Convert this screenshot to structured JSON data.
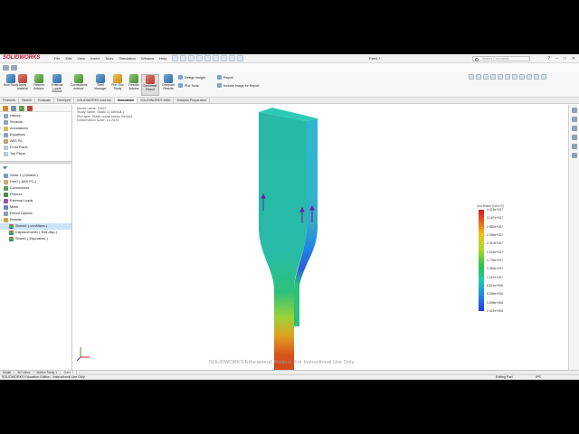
{
  "app": {
    "logo": "SOLIDWORKS",
    "document_title": "Part1 *",
    "menu": [
      "File",
      "Edit",
      "View",
      "Insert",
      "Tools",
      "Simulation",
      "Window",
      "Help"
    ],
    "search_placeholder": "Search Commands",
    "window_controls": [
      "?",
      "–",
      "□",
      "✕"
    ]
  },
  "command_manager": {
    "buttons": [
      {
        "label": "New Study",
        "icon": "new-study-icon"
      },
      {
        "label": "Apply Material",
        "icon": "apply-material-icon"
      },
      {
        "label": "Fixtures Advisor",
        "icon": "fixtures-icon"
      },
      {
        "label": "External Loads Advisor",
        "icon": "loads-icon"
      },
      {
        "label": "Connections Advisor",
        "icon": "connections-icon"
      },
      {
        "label": "Shell Manager",
        "icon": "shell-icon"
      },
      {
        "label": "Run This Study",
        "icon": "run-icon"
      },
      {
        "label": "Results Advisor",
        "icon": "results-icon"
      },
      {
        "label": "Deformed Result",
        "icon": "deformed-icon"
      },
      {
        "label": "Compare Results",
        "icon": "compare-icon"
      }
    ],
    "small_buttons": [
      "Design Insight",
      "Plot Tools",
      "Report",
      "Include Image for Report"
    ]
  },
  "tabs": [
    "Features",
    "Sketch",
    "Evaluate",
    "DimXpert",
    "SOLIDWORKS Add-Ins",
    "Simulation",
    "SOLIDWORKS MBD",
    "Analysis Preparation"
  ],
  "active_tab": "Simulation",
  "feature_tree": [
    {
      "label": "History",
      "icon": "history-icon",
      "expand": "›"
    },
    {
      "label": "Sensors",
      "icon": "sensor-icon",
      "expand": ""
    },
    {
      "label": "Annotations",
      "icon": "annotation-icon",
      "expand": "›"
    },
    {
      "label": "Equations",
      "icon": "equation-icon",
      "expand": "›"
    },
    {
      "label": "ABS PC",
      "icon": "material-icon",
      "expand": ""
    },
    {
      "label": "Front Plane",
      "icon": "plane-icon",
      "expand": ""
    },
    {
      "label": "Top Plane",
      "icon": "plane-icon",
      "expand": ""
    }
  ],
  "study_tree": [
    {
      "label": "Static 1 (-Default-)",
      "icon": "study-icon",
      "expand": "",
      "selected": false
    },
    {
      "label": "Part1 (-ABS PC-)",
      "icon": "part-icon",
      "expand": "›",
      "selected": false
    },
    {
      "label": "Connections",
      "icon": "connections-icon",
      "expand": "",
      "selected": false
    },
    {
      "label": "Fixtures",
      "icon": "fixture-icon",
      "expand": "›",
      "selected": false
    },
    {
      "label": "External Loads",
      "icon": "load-icon",
      "expand": "›",
      "selected": false
    },
    {
      "label": "Mesh",
      "icon": "mesh-icon",
      "expand": "",
      "selected": false
    },
    {
      "label": "Result Options",
      "icon": "options-icon",
      "expand": "",
      "selected": false
    },
    {
      "label": "Results",
      "icon": "results-icon",
      "expand": "⌄",
      "selected": false
    },
    {
      "label": "Stress1 (-vonMises-)",
      "icon": "stress-plot-icon",
      "expand": "",
      "selected": true
    },
    {
      "label": "Displacement1 (-Res disp-)",
      "icon": "displacement-plot-icon",
      "expand": "",
      "selected": false
    },
    {
      "label": "Strain1 (-Equivalent-)",
      "icon": "strain-plot-icon",
      "expand": "",
      "selected": false
    }
  ],
  "viewport": {
    "study_info": [
      "Model name: Part1",
      "Study name: Static 1(-Default-)",
      "Plot type: Static nodal stress Stress1",
      "Deformation scale: 14.2633"
    ],
    "watermark": "SOLIDWORKS Educational Product. For Instructional Use Only."
  },
  "legend": {
    "title": "von Mises (N/m^2)",
    "values": [
      "3.415e+007",
      "3.167e+007",
      "2.882e+007",
      "2.596e+007",
      "2.310e+007",
      "2.024e+007",
      "1.739e+007",
      "1.453e+007",
      "1.167e+007",
      "8.814e+006",
      "5.956e+006",
      "3.098e+006",
      "2.401e+005"
    ],
    "colors": [
      "#d21e1e",
      "#f0c21c",
      "#2cc44a",
      "#22c9b2",
      "#1c3cd8"
    ]
  },
  "bottom_tabs": [
    "Model",
    "3D Views",
    "Motion Study 1",
    "Static 1"
  ],
  "active_bottom_tab": "Static 1",
  "status": {
    "left": "SOLIDWORKS Education Edition - Instructional Use Only",
    "mode": "Editing Part",
    "units": "IPS"
  }
}
